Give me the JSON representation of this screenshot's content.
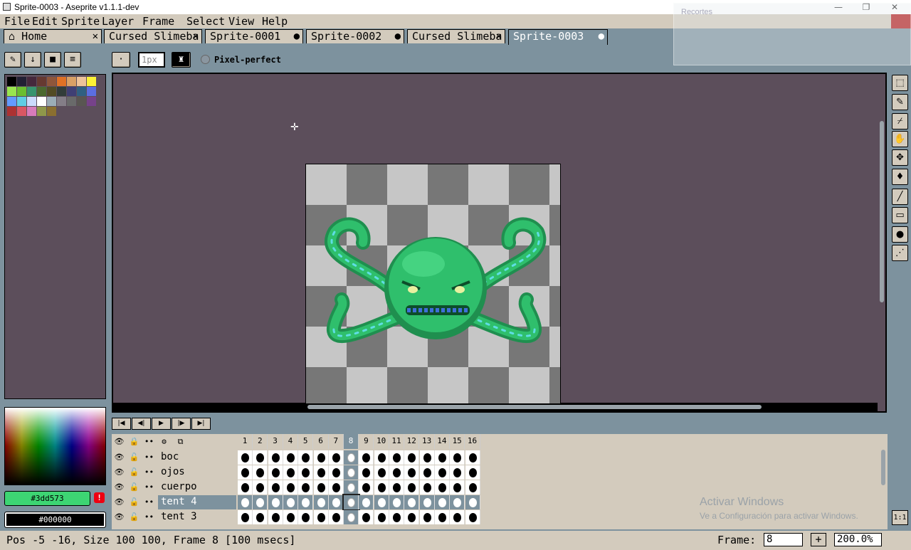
{
  "window": {
    "title": "Sprite-0003 - Aseprite v1.1.1-dev",
    "minimize": "—",
    "restore": "❐",
    "close": "✕"
  },
  "menu": [
    "File",
    "Edit",
    "Sprite",
    "Layer",
    "Frame",
    "Select",
    "View",
    "Help"
  ],
  "tabs": [
    {
      "label": "Home",
      "icon": "⌂",
      "close": "✕"
    },
    {
      "label": "Cursed Slimeba",
      "close": "✕"
    },
    {
      "label": "Sprite-0001",
      "close": "●"
    },
    {
      "label": "Sprite-0002",
      "close": "●"
    },
    {
      "label": "Cursed Slimeba",
      "close": "✕"
    },
    {
      "label": "Sprite-0003",
      "close": "●",
      "active": true
    }
  ],
  "recortes": {
    "title": "Recortes"
  },
  "context_bar": {
    "brush_size": "1px",
    "pixel_perfect": "Pixel-perfect"
  },
  "palette_colors": [
    "#000000",
    "#222034",
    "#45283c",
    "#663931",
    "#8f563b",
    "#df7126",
    "#d9a066",
    "#eec39a",
    "#fbf236",
    "#99e550",
    "#6abe30",
    "#37946e",
    "#4b692f",
    "#524b24",
    "#323c39",
    "#3f3f74",
    "#306082",
    "#5b6ee1",
    "#639bff",
    "#5fcde4",
    "#cbdbfc",
    "#ffffff",
    "#9badb7",
    "#847e87",
    "#696a6a",
    "#595652",
    "#76428a",
    "#ac3232",
    "#d95763",
    "#d77bba",
    "#8f974a",
    "#8a6f30"
  ],
  "colors": {
    "foreground": "#3dd573",
    "background": "#000000",
    "accent": "#7d929e",
    "panel": "#5c4e5b"
  },
  "timeline": {
    "header_icons": [
      "👁",
      "🔒",
      "••",
      "⚙",
      "⧉"
    ],
    "frames": [
      "1",
      "2",
      "3",
      "4",
      "5",
      "6",
      "7",
      "8",
      "9",
      "10",
      "11",
      "12",
      "13",
      "14",
      "15",
      "16"
    ],
    "selected_frame": 8,
    "layers": [
      {
        "name": "boc"
      },
      {
        "name": "ojos"
      },
      {
        "name": "cuerpo"
      },
      {
        "name": "tent 4",
        "selected": true
      },
      {
        "name": "tent 3"
      }
    ]
  },
  "status": {
    "text": "Pos -5 -16, Size 100 100, Frame 8 [100 msecs]",
    "frame_label": "Frame:",
    "frame_value": "8",
    "plus": "+",
    "zoom": "200.0%",
    "ratio": "1:1"
  },
  "activate_windows": {
    "line1": "Activar Windows",
    "line2": "Ve a Configuración para activar Windows."
  }
}
